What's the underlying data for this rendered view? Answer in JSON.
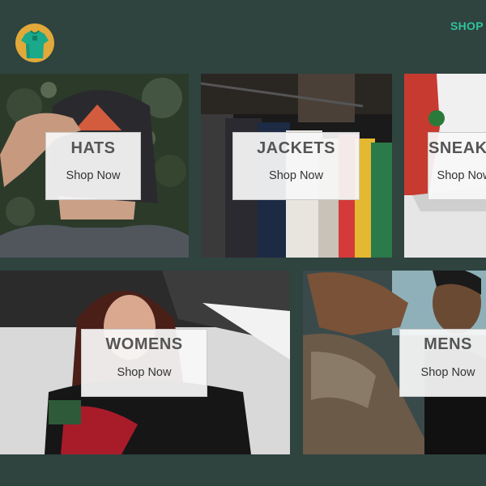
{
  "header": {
    "logo_icon": "tshirt-icon",
    "nav": {
      "shop_label": "SHOP"
    }
  },
  "colors": {
    "background": "#2f433f",
    "accent": "#2ec49b",
    "logo_circle": "#e0a93a",
    "logo_shirt": "#1aa98a"
  },
  "directory": {
    "items": [
      {
        "title": "HATS",
        "link": "Shop Now"
      },
      {
        "title": "JACKETS",
        "link": "Shop Now"
      },
      {
        "title": "SNEAKERS",
        "link": "Shop Now"
      },
      {
        "title": "WOMENS",
        "link": "Shop Now"
      },
      {
        "title": "MENS",
        "link": "Shop Now"
      }
    ]
  }
}
